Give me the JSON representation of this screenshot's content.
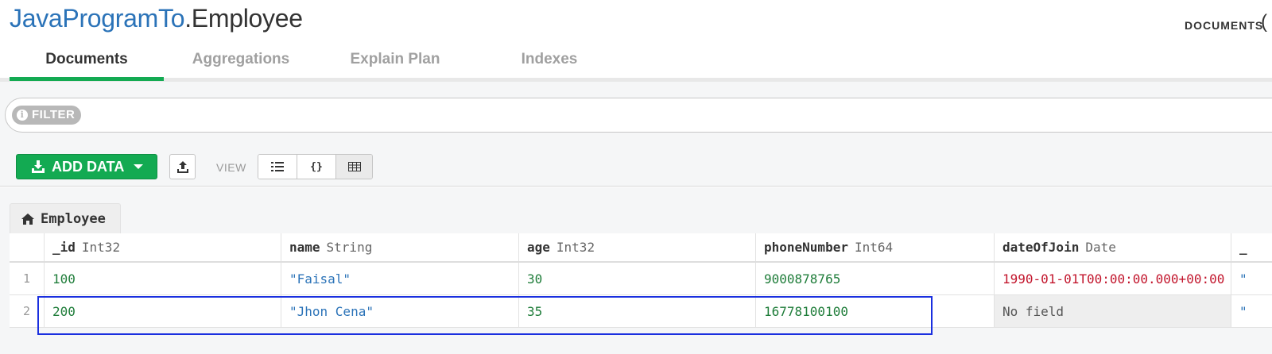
{
  "header": {
    "db_name": "JavaProgramTo",
    "collection_name": ".Employee",
    "documents_label": "DOCUMENTS"
  },
  "tabs": [
    {
      "label": "Documents",
      "active": true
    },
    {
      "label": "Aggregations",
      "active": false
    },
    {
      "label": "Explain Plan",
      "active": false
    },
    {
      "label": "Indexes",
      "active": false
    }
  ],
  "filter": {
    "pill_label": "FILTER",
    "pill_icon": "info-icon"
  },
  "toolbar": {
    "add_data_label": "ADD DATA",
    "view_label": "VIEW",
    "view_modes": [
      "list",
      "json",
      "table"
    ],
    "active_view": "table"
  },
  "table": {
    "collection_tab": "Employee",
    "columns": [
      {
        "name": "_id",
        "type": "Int32"
      },
      {
        "name": "name",
        "type": "String"
      },
      {
        "name": "age",
        "type": "Int32"
      },
      {
        "name": "phoneNumber",
        "type": "Int64"
      },
      {
        "name": "dateOfJoin",
        "type": "Date"
      },
      {
        "name": "_",
        "type": ""
      }
    ],
    "rows": [
      {
        "num": "1",
        "id": "100",
        "name": "\"Faisal\"",
        "age": "30",
        "phone": "9000878765",
        "date": "1990-01-01T00:00:00.000+00:00",
        "last": "\""
      },
      {
        "num": "2",
        "id": "200",
        "name": "\"Jhon Cena\"",
        "age": "35",
        "phone": "16778100100",
        "date": "No field",
        "last": "\""
      }
    ]
  },
  "colors": {
    "accent": "#13aa52",
    "link_blue": "#2b73b8",
    "highlight_box": "#1a2fdf"
  }
}
